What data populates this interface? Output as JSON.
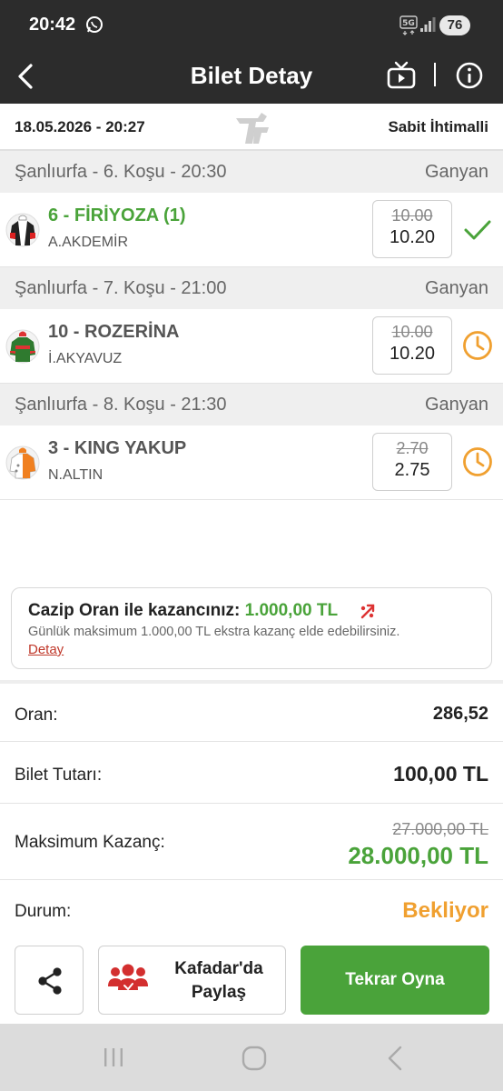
{
  "status_bar": {
    "time": "20:42",
    "battery": "76",
    "notification_icon": "whatsapp-icon",
    "network_icon": "5g-icon",
    "signal_icon": "signal-icon"
  },
  "header": {
    "title": "Bilet Detay",
    "back_icon": "chevron-left-icon",
    "tv_icon": "tv-icon",
    "info_icon": "info-icon"
  },
  "ticket": {
    "date": "18.05.2026 - 20:27",
    "type": "Sabit İhtimalli",
    "logo_icon": "tjk-logo-icon"
  },
  "races": [
    {
      "title": "Şanlıurfa - 6. Koşu - 20:30",
      "bet_type": "Ganyan",
      "horse": "6 - FİRİYOZA (1)",
      "jockey": "A.AKDEMİR",
      "odds_old": "10.00",
      "odds_new": "10.20",
      "status": "won",
      "status_icon": "check-icon"
    },
    {
      "title": "Şanlıurfa - 7. Koşu - 21:00",
      "bet_type": "Ganyan",
      "horse": "10 - ROZERİNA",
      "jockey": "İ.AKYAVUZ",
      "odds_old": "10.00",
      "odds_new": "10.20",
      "status": "pending",
      "status_icon": "clock-icon"
    },
    {
      "title": "Şanlıurfa - 8. Koşu - 21:30",
      "bet_type": "Ganyan",
      "horse": "3 - KING YAKUP",
      "jockey": "N.ALTIN",
      "odds_old": "2.70",
      "odds_new": "2.75",
      "status": "pending",
      "status_icon": "clock-icon"
    }
  ],
  "promo": {
    "title_prefix": "Cazip Oran ile kazancınız:",
    "amount": "1.000,00 TL",
    "description": "Günlük maksimum 1.000,00 TL ekstra kazanç elde edebilirsiniz.",
    "link": "Detay"
  },
  "summary": {
    "odds_label": "Oran:",
    "odds_value": "286,52",
    "amount_label": "Bilet Tutarı:",
    "amount_value": "100,00 TL",
    "max_label": "Maksimum Kazanç:",
    "max_old": "27.000,00 TL",
    "max_new": "28.000,00 TL",
    "status_label": "Durum:",
    "status_value": "Bekliyor"
  },
  "actions": {
    "share_icon": "share-icon",
    "kafadar_label": "Kafadar'da Paylaş",
    "kafadar_icon": "group-users-icon",
    "replay_label": "Tekrar Oyna"
  },
  "colors": {
    "header_bg": "#2c2c2c",
    "accent_green": "#4aa33a",
    "pending_orange": "#f0a030",
    "link_red": "#c0392b",
    "section_gray": "#efefef"
  }
}
